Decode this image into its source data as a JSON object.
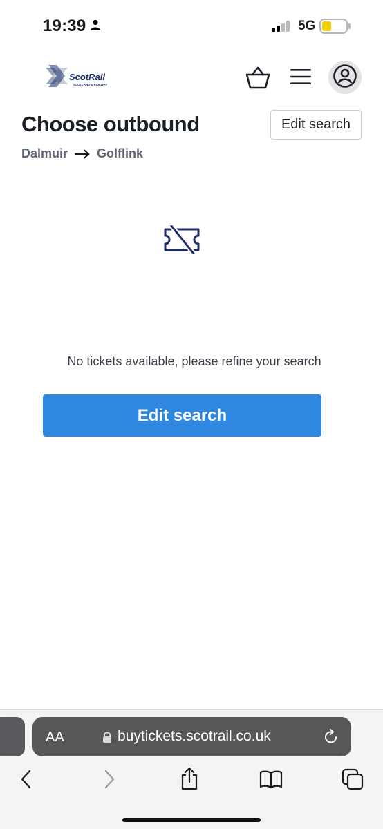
{
  "status_bar": {
    "time": "19:39",
    "network": "5G"
  },
  "header": {
    "logo_text": "ScotRail",
    "logo_tagline": "SCOTLAND'S RAILWAY"
  },
  "main": {
    "title": "Choose outbound",
    "edit_search_label": "Edit search",
    "route": {
      "from": "Dalmuir",
      "to": "Golflink"
    },
    "empty_message": "No tickets available, please refine your search",
    "primary_button_label": "Edit search",
    "accent_color": "#2f87df",
    "icon_color": "#1c2d6b"
  },
  "browser": {
    "text_size_label": "AA",
    "url": "buytickets.scotrail.co.uk"
  }
}
